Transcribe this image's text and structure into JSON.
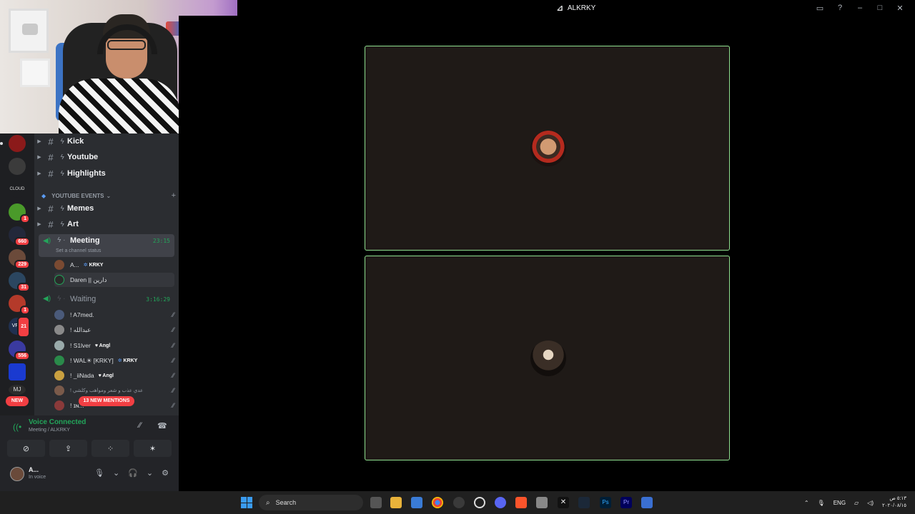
{
  "window": {
    "title": "ALKRKY"
  },
  "servers": {
    "badges": [
      "1",
      "660",
      "229",
      "31",
      "1",
      "21",
      "556"
    ],
    "new_label": "NEW",
    "colors": [
      "#8b1a1a",
      "#444",
      "#2c2c2c",
      "#3a8c2a",
      "#2a2a40",
      "#6b4a3a",
      "#345",
      "#b43a2a",
      "#203050",
      "#2030a0",
      "#1a3aa0",
      "#333"
    ]
  },
  "channels": {
    "kick": "Kick",
    "youtube": "Youtube",
    "highlights": "Highlights",
    "category": "YOUTUBE EVENTS",
    "memes": "Memes",
    "art": "Art",
    "meeting": {
      "name": "Meeting",
      "time": "23:15",
      "status": "Set a channel status"
    },
    "meeting_users": [
      {
        "name": "A...",
        "tag": "KRKY"
      },
      {
        "name": "Daren || دارين",
        "tag": ""
      }
    ],
    "waiting": {
      "name": "Waiting",
      "time": "3:16:29"
    },
    "waiting_users": [
      {
        "name": "! A7med.",
        "tag": ""
      },
      {
        "name": "! عبدالله",
        "tag": ""
      },
      {
        "name": "! S1lver",
        "tag": "Angl"
      },
      {
        "name": "! WAL☀  [KRKY]",
        "tag": "KRKY"
      },
      {
        "name": "! _iiNada",
        "tag": "Angl"
      },
      {
        "name": "! عدي عذب و شعر ومواهب وكلشي",
        "tag": ""
      },
      {
        "name": "! ɪɴ...",
        "tag": ""
      }
    ],
    "mentions": "13 NEW MENTIONS"
  },
  "voice": {
    "status": "Voice Connected",
    "location": "Meeting / ALKRKY"
  },
  "me": {
    "name": "A...",
    "status": "In voice"
  },
  "taskbar": {
    "search": "Search",
    "lang": "ENG",
    "time": "٥:١٣ ص",
    "date": "٢٠٢٠/٠٨/١٥"
  },
  "colors": {
    "accent_green": "#23a55a",
    "tile_border": "#8fe08f",
    "badge_red": "#f23f43"
  }
}
